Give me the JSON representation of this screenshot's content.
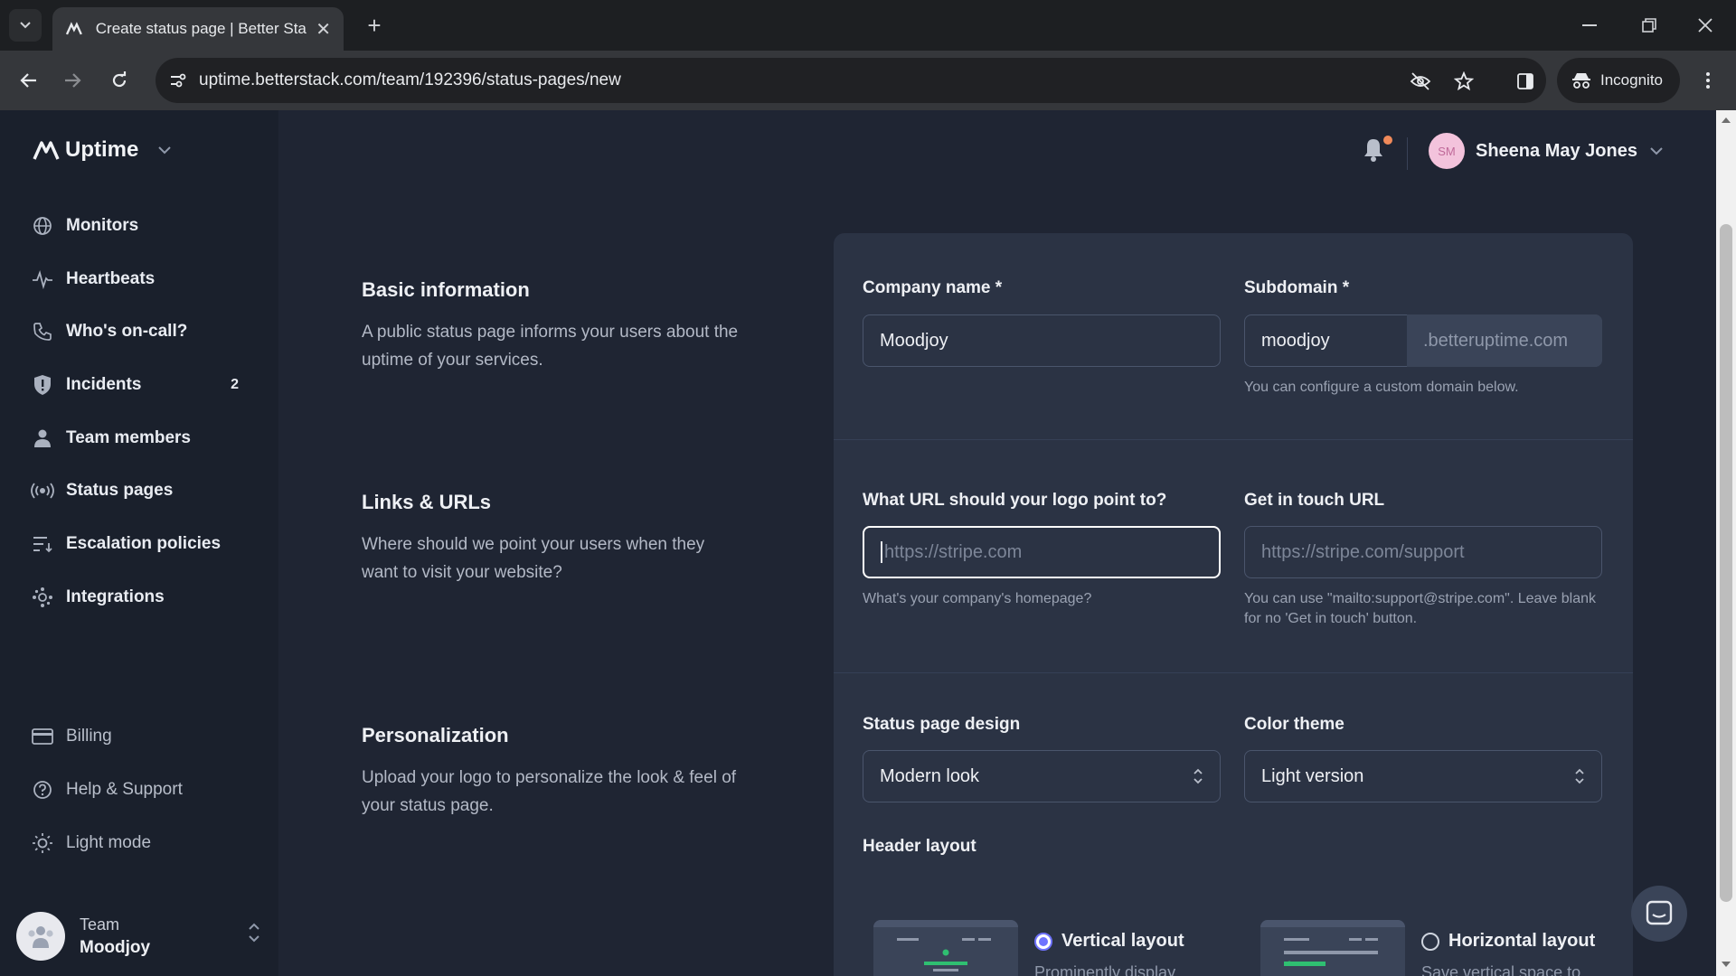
{
  "browser": {
    "tab_title": "Create status page | Better Stac",
    "url": "uptime.betterstack.com/team/192396/status-pages/new",
    "incognito_label": "Incognito"
  },
  "sidebar": {
    "brand": "Uptime",
    "items": [
      {
        "label": "Monitors",
        "icon": "globe-icon"
      },
      {
        "label": "Heartbeats",
        "icon": "heartbeat-icon"
      },
      {
        "label": "Who's on-call?",
        "icon": "phone-icon"
      },
      {
        "label": "Incidents",
        "icon": "shield-icon",
        "badge": "2"
      },
      {
        "label": "Team members",
        "icon": "person-icon"
      },
      {
        "label": "Status pages",
        "icon": "broadcast-icon"
      },
      {
        "label": "Escalation policies",
        "icon": "escalation-icon"
      },
      {
        "label": "Integrations",
        "icon": "integrations-icon"
      }
    ],
    "secondary": [
      {
        "label": "Billing",
        "icon": "card-icon"
      },
      {
        "label": "Help & Support",
        "icon": "help-icon"
      },
      {
        "label": "Light mode",
        "icon": "sun-icon"
      }
    ],
    "team": {
      "label": "Team",
      "name": "Moodjoy"
    }
  },
  "header": {
    "user_initials": "SM",
    "user_name": "Sheena May Jones"
  },
  "sections": {
    "basic": {
      "title": "Basic information",
      "desc": "A public status page informs your users about the uptime of your services."
    },
    "links": {
      "title": "Links & URLs",
      "desc": "Where should we point your users when they want to visit your website?"
    },
    "personalization": {
      "title": "Personalization",
      "desc": "Upload your logo to personalize the look & feel of your status page."
    }
  },
  "form": {
    "company_name": {
      "label": "Company name *",
      "value": "Moodjoy"
    },
    "subdomain": {
      "label": "Subdomain *",
      "value": "moodjoy",
      "suffix": ".betteruptime.com",
      "help": "You can configure a custom domain below."
    },
    "logo_url": {
      "label": "What URL should your logo point to?",
      "placeholder": "https://stripe.com",
      "help": "What's your company's homepage?"
    },
    "contact_url": {
      "label": "Get in touch URL",
      "placeholder": "https://stripe.com/support",
      "help": "You can use \"mailto:support@stripe.com\". Leave blank for no 'Get in touch' button."
    },
    "design": {
      "label": "Status page design",
      "value": "Modern look"
    },
    "theme": {
      "label": "Color theme",
      "value": "Light version"
    },
    "header_layout": {
      "label": "Header layout",
      "vertical": {
        "label": "Vertical layout",
        "sub": "Prominently display",
        "selected": true
      },
      "horizontal": {
        "label": "Horizontal layout",
        "sub": "Save vertical space to",
        "selected": false
      }
    }
  },
  "colors": {
    "accent": "#6f73ff",
    "notification": "#f08a5a"
  }
}
